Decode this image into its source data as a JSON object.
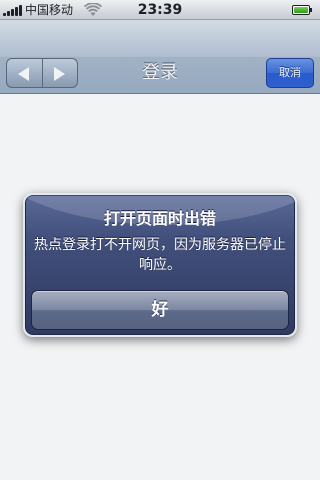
{
  "status_bar": {
    "carrier": "中国移动",
    "time": "23:39",
    "signal_icon": "signal-bars-icon",
    "wifi_icon": "wifi-icon",
    "battery_icon": "battery-icon",
    "battery_level": 0.85
  },
  "nav_bar": {
    "title": "登录",
    "cancel_label": "取消",
    "back_icon": "back-arrow-icon",
    "forward_icon": "forward-arrow-icon"
  },
  "alert": {
    "title": "打开页面时出错",
    "message": "热点登录打不开网页，因为服务器已停止响应。",
    "ok_label": "好"
  },
  "colors": {
    "cancel_button": "#2f63d9",
    "alert_background": "#2f3a61",
    "battery": "#2f9d1d"
  }
}
